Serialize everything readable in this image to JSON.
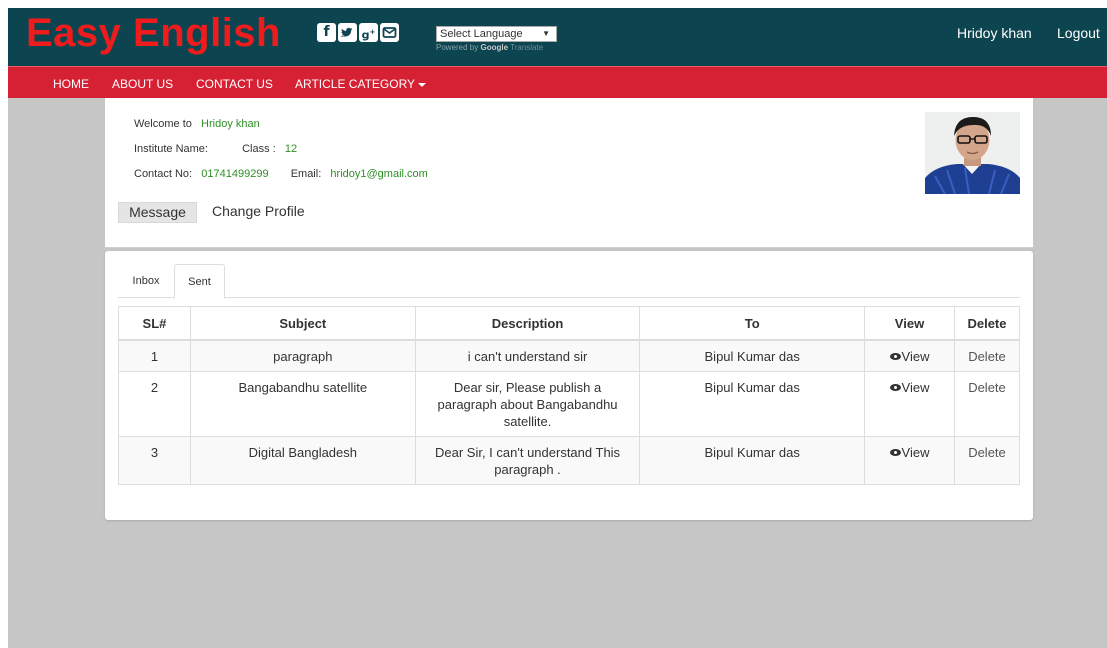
{
  "header": {
    "brand": "Easy English",
    "social": [
      {
        "icon": "facebook-icon",
        "glyph": "f"
      },
      {
        "icon": "twitter-icon",
        "glyph": "t"
      },
      {
        "icon": "google-plus-icon",
        "glyph": "g+"
      },
      {
        "icon": "email-icon",
        "glyph": "✉"
      }
    ],
    "language_select": "Select Language",
    "powered_by": "Powered by",
    "powered_google": "Google",
    "powered_translate": "Translate",
    "user_name": "Hridoy khan",
    "logout": "Logout"
  },
  "nav": {
    "home": "HOME",
    "about": "ABOUT US",
    "contact": "CONTACT US",
    "article_category": "ARTICLE CATEGORY"
  },
  "profile": {
    "welcome_label": "Welcome to",
    "welcome_value": "Hridoy khan",
    "institute_label": "Institute Name:",
    "class_label": "Class :",
    "class_value": "12",
    "contact_label": "Contact No:",
    "contact_value": "01741499299",
    "email_label": "Email:",
    "email_value": "hridoy1@gmail.com",
    "message_button": "Message",
    "change_profile": "Change Profile"
  },
  "tabs": {
    "inbox": "Inbox",
    "sent": "Sent"
  },
  "table": {
    "headers": [
      "SL#",
      "Subject",
      "Description",
      "To",
      "View",
      "Delete"
    ],
    "rows": [
      {
        "sl": "1",
        "subject": "paragraph",
        "description": "i can't understand sir",
        "to": "Bipul Kumar das",
        "view": "View",
        "delete": "Delete"
      },
      {
        "sl": "2",
        "subject": "Bangabandhu satellite",
        "description": "Dear sir, Please publish a paragraph about Bangabandhu satellite.",
        "to": "Bipul Kumar das",
        "view": "View",
        "delete": "Delete"
      },
      {
        "sl": "3",
        "subject": "Digital Bangladesh",
        "description": "Dear Sir, I can't understand This paragraph .",
        "to": "Bipul Kumar das",
        "view": "View",
        "delete": "Delete"
      }
    ]
  },
  "colors": {
    "header_bg": "#0c4450",
    "brand_red": "#ee1c1c",
    "nav_red": "#d52133",
    "value_green": "#2f8f24",
    "page_gray": "#c6c6c6"
  }
}
